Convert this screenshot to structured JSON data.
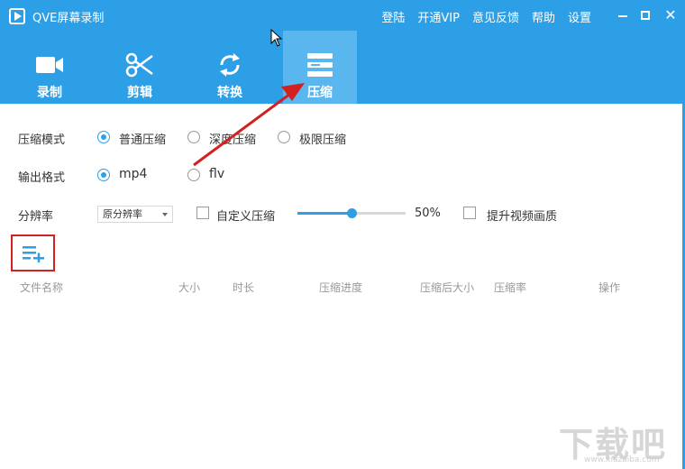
{
  "app": {
    "title": "QVE屏幕录制",
    "accent_color": "#2d9fe6"
  },
  "top_links": [
    "登陆",
    "开通VIP",
    "意见反馈",
    "帮助",
    "设置"
  ],
  "window_controls": {
    "minimize": "minimize-icon",
    "maximize": "maximize-icon",
    "close": "✕"
  },
  "tabs": [
    {
      "label": "录制",
      "icon": "video-camera-icon"
    },
    {
      "label": "剪辑",
      "icon": "scissors-icon"
    },
    {
      "label": "转换",
      "icon": "refresh-icon"
    },
    {
      "label": "压缩",
      "icon": "compress-icon",
      "active": true
    }
  ],
  "compress_mode": {
    "label": "压缩模式",
    "options": [
      "普通压缩",
      "深度压缩",
      "极限压缩"
    ],
    "selected": "普通压缩"
  },
  "output_format": {
    "label": "输出格式",
    "options": [
      "mp4",
      "flv"
    ],
    "selected": "mp4"
  },
  "resolution": {
    "label": "分辨率",
    "selected": "原分辨率",
    "custom_compress_label": "自定义压缩",
    "custom_compress_checked": false,
    "slider_value": 0.5,
    "slider_text": "50%",
    "improve_quality_label": "提升视频画质",
    "improve_quality_checked": false
  },
  "add_list_icon": "add-to-list-icon",
  "table": {
    "columns": [
      "文件名称",
      "大小",
      "时长",
      "压缩进度",
      "压缩后大小",
      "压缩率",
      "操作"
    ]
  },
  "watermark": {
    "text": "下载吧",
    "url": "www.xiazaiba.com"
  }
}
